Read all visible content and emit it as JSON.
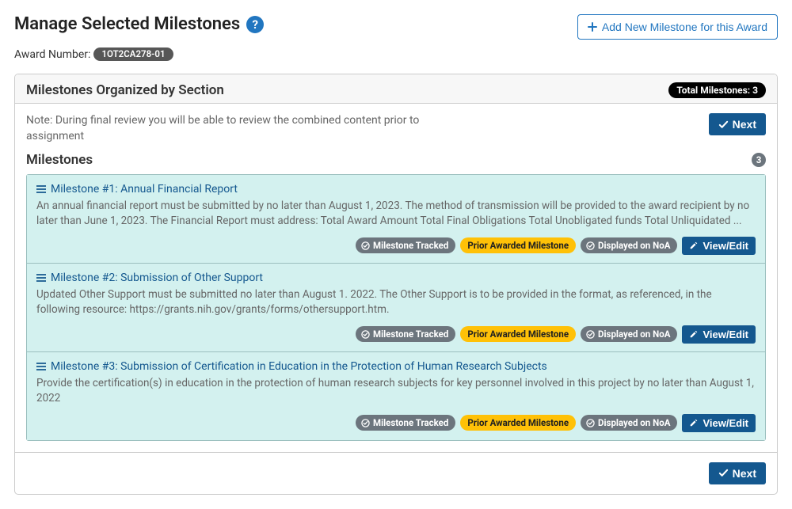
{
  "header": {
    "title": "Manage Selected Milestones",
    "help_tooltip": "?",
    "add_button": "Add New Milestone for this Award"
  },
  "award": {
    "label": "Award Number:",
    "number": "1OT2CA278-01"
  },
  "panel": {
    "title": "Milestones Organized by Section",
    "total_label": "Total Milestones: 3",
    "note": "Note: During final review you will be able to review the combined content prior to assignment",
    "next_label": "Next",
    "section_title": "Milestones",
    "section_count": "3"
  },
  "badges": {
    "tracked": "Milestone Tracked",
    "prior": "Prior Awarded Milestone",
    "noa": "Displayed on NoA",
    "view": "View/Edit"
  },
  "milestones": [
    {
      "title": "Milestone #1: Annual Financial Report",
      "desc": "An annual financial report must be submitted by no later than August 1, 2023. The method of transmission will be provided to the award recipient by no later than June 1, 2023. The Financial Report must address: Total Award Amount Total Final Obligations Total Unobligated funds Total Unliquidated ..."
    },
    {
      "title": "Milestone #2: Submission of Other Support",
      "desc": "Updated Other Support must be submitted no later than August 1. 2022. The Other Support is to be provided in the format, as referenced, in the following resource: https://grants.nih.gov/grants/forms/othersupport.htm."
    },
    {
      "title": "Milestone #3: Submission of Certification in Education in the Protection of Human Research Subjects",
      "desc": "Provide the certification(s) in education in the protection of human research subjects for key personnel involved in this project by no later than August 1, 2022"
    }
  ]
}
